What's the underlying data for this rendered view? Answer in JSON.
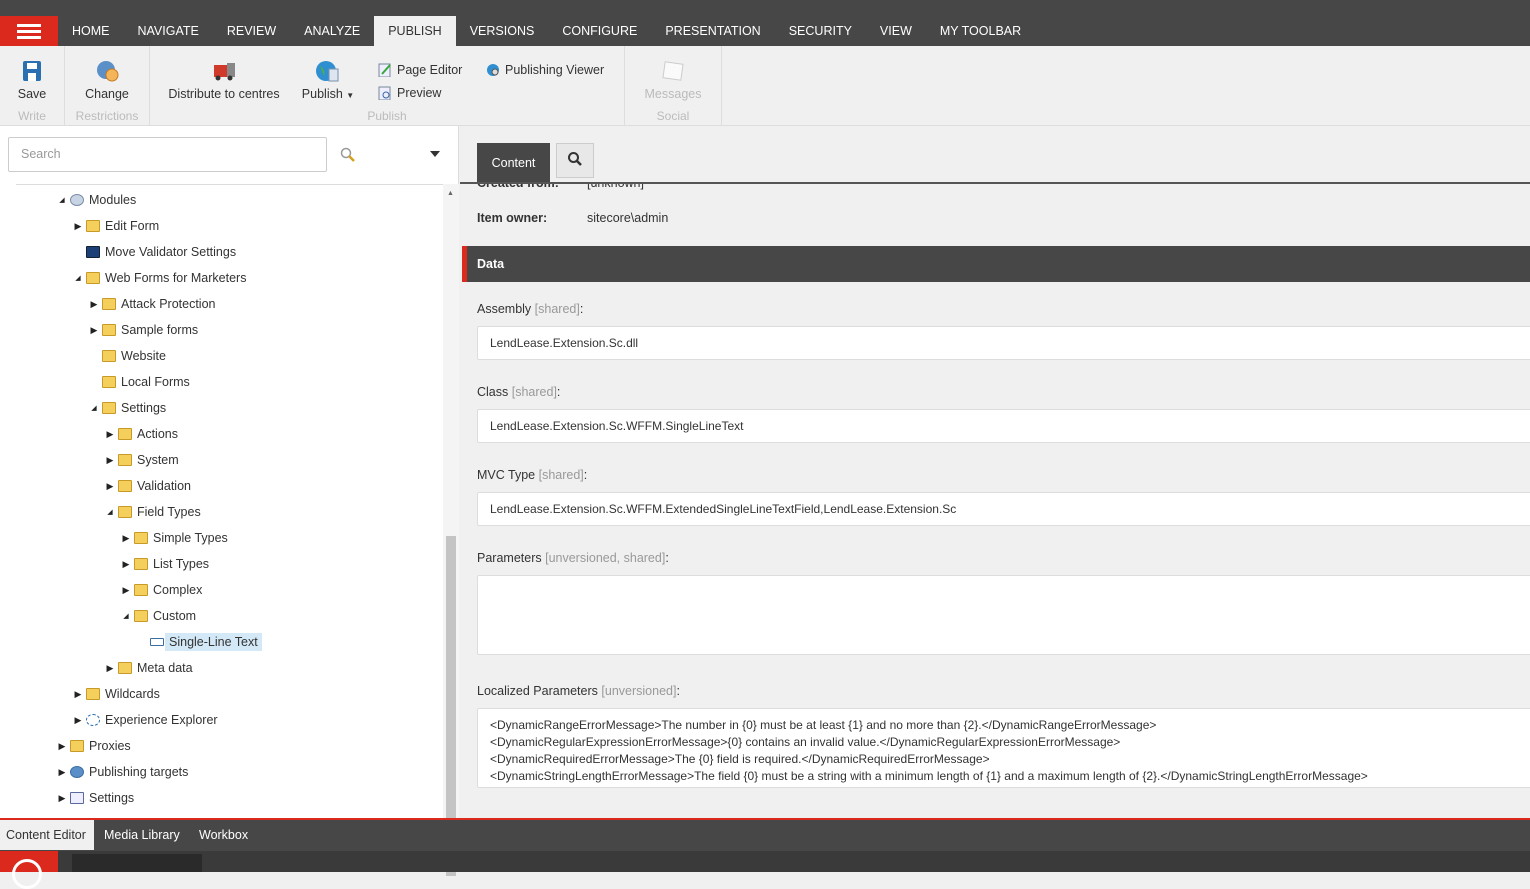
{
  "ribbon_tabs": [
    "HOME",
    "NAVIGATE",
    "REVIEW",
    "ANALYZE",
    "PUBLISH",
    "VERSIONS",
    "CONFIGURE",
    "PRESENTATION",
    "SECURITY",
    "VIEW",
    "MY TOOLBAR"
  ],
  "active_tab": "PUBLISH",
  "ribbon": {
    "write": {
      "save": "Save",
      "group": "Write"
    },
    "restrictions": {
      "change": "Change",
      "group": "Restrictions"
    },
    "publish": {
      "distribute": "Distribute to centres",
      "publish": "Publish",
      "page_editor": "Page Editor",
      "preview": "Preview",
      "publishing_viewer": "Publishing Viewer",
      "group": "Publish"
    },
    "social": {
      "messages": "Messages",
      "group": "Social"
    }
  },
  "search": {
    "placeholder": "Search"
  },
  "tree": [
    {
      "level": 0,
      "exp": "open",
      "label": "Modules",
      "icon": "modules-icon"
    },
    {
      "level": 1,
      "exp": "closed",
      "label": "Edit Form",
      "icon": "folder-icon"
    },
    {
      "level": 1,
      "exp": "none",
      "label": "Move Validator Settings",
      "icon": "settings-item-icon"
    },
    {
      "level": 1,
      "exp": "open",
      "label": "Web Forms for Marketers",
      "icon": "folder-icon"
    },
    {
      "level": 2,
      "exp": "closed",
      "label": "Attack Protection",
      "icon": "folder-icon"
    },
    {
      "level": 2,
      "exp": "closed",
      "label": "Sample forms",
      "icon": "folder-icon"
    },
    {
      "level": 2,
      "exp": "none",
      "label": "Website",
      "icon": "folder-icon"
    },
    {
      "level": 2,
      "exp": "none",
      "label": "Local Forms",
      "icon": "folder-icon"
    },
    {
      "level": 2,
      "exp": "open",
      "label": "Settings",
      "icon": "folder-icon"
    },
    {
      "level": 3,
      "exp": "closed",
      "label": "Actions",
      "icon": "folder-icon"
    },
    {
      "level": 3,
      "exp": "closed",
      "label": "System",
      "icon": "folder-icon"
    },
    {
      "level": 3,
      "exp": "closed",
      "label": "Validation",
      "icon": "folder-icon"
    },
    {
      "level": 3,
      "exp": "open",
      "label": "Field Types",
      "icon": "folder-icon"
    },
    {
      "level": 4,
      "exp": "closed",
      "label": "Simple Types",
      "icon": "folder-icon"
    },
    {
      "level": 4,
      "exp": "closed",
      "label": "List Types",
      "icon": "folder-icon"
    },
    {
      "level": 4,
      "exp": "closed",
      "label": "Complex",
      "icon": "folder-icon"
    },
    {
      "level": 4,
      "exp": "open",
      "label": "Custom",
      "icon": "folder-icon"
    },
    {
      "level": 5,
      "exp": "none",
      "label": "Single-Line Text",
      "icon": "textbox-icon",
      "selected": true
    },
    {
      "level": 3,
      "exp": "closed",
      "label": "Meta data",
      "icon": "folder-icon"
    },
    {
      "level": 1,
      "exp": "closed",
      "label": "Wildcards",
      "icon": "folder-icon"
    },
    {
      "level": 1,
      "exp": "closed",
      "label": "Experience Explorer",
      "icon": "experience-icon"
    },
    {
      "level": 0,
      "exp": "closed",
      "label": "Proxies",
      "icon": "folder-icon"
    },
    {
      "level": 0,
      "exp": "closed",
      "label": "Publishing targets",
      "icon": "publishing-targets-icon"
    },
    {
      "level": 0,
      "exp": "closed",
      "label": "Settings",
      "icon": "settings-icon"
    }
  ],
  "content": {
    "tab": "Content",
    "created_from_label": "Created from:",
    "created_from_value": "[unknown]",
    "owner_label": "Item owner:",
    "owner_value": "sitecore\\admin",
    "section": "Data",
    "fields": [
      {
        "label": "Assembly",
        "meta": "[shared]",
        "value": "LendLease.Extension.Sc.dll"
      },
      {
        "label": "Class",
        "meta": "[shared]",
        "value": "LendLease.Extension.Sc.WFFM.SingleLineText"
      },
      {
        "label": "MVC Type",
        "meta": "[shared]",
        "value": "LendLease.Extension.Sc.WFFM.ExtendedSingleLineTextField,LendLease.Extension.Sc"
      },
      {
        "label": "Parameters",
        "meta": "[unversioned, shared]",
        "value": ""
      },
      {
        "label": "Localized Parameters",
        "meta": "[unversioned]",
        "lines": [
          "<DynamicRangeErrorMessage>The number in {0} must be at least {1} and no more than {2}.</DynamicRangeErrorMessage>",
          "<DynamicRegularExpressionErrorMessage>{0} contains an invalid value.</DynamicRegularExpressionErrorMessage>",
          "<DynamicRequiredErrorMessage>The {0} field is required.</DynamicRequiredErrorMessage>",
          "<DynamicStringLengthErrorMessage>The field {0} must be a string with a minimum length of {1} and a maximum length of {2}.</DynamicStringLengthErrorMessage>"
        ]
      }
    ]
  },
  "bottom_tabs": [
    "Content Editor",
    "Media Library",
    "Workbox"
  ],
  "colors": {
    "accent": "#dc291e",
    "dark": "#474747"
  }
}
